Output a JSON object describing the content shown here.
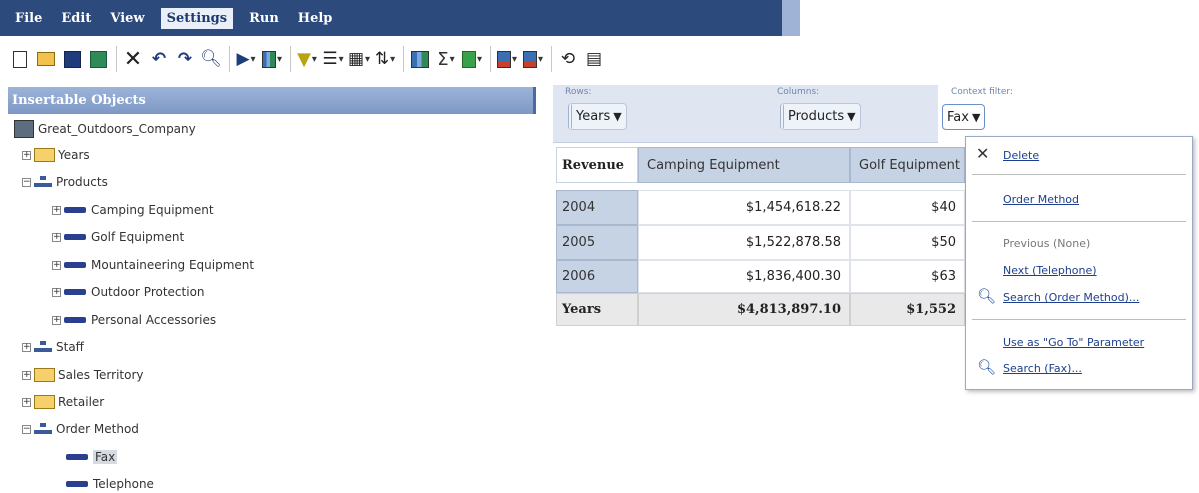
{
  "menu": [
    "File",
    "Edit",
    "View",
    "Settings",
    "Run",
    "Help"
  ],
  "menu_active": "Settings",
  "toolbar_icons": [
    "new-document-icon",
    "open-folder-icon",
    "save-icon",
    "save-as-icon",
    "delete-icon",
    "undo-icon",
    "redo-icon",
    "find-icon",
    "run-icon",
    "chart-type-icon",
    "filter-icon",
    "sort-icon",
    "summarize-icon",
    "explore-icon",
    "calculate-icon",
    "sum-icon",
    "insert-chart-icon",
    "chart-icon",
    "chart-config-icon",
    "refresh-icon",
    "properties-icon"
  ],
  "left_panel": {
    "title": "Insertable Objects",
    "package": "Great_Outdoors_Company",
    "items": {
      "years": "Years",
      "products": "Products",
      "camping": "Camping Equipment",
      "golf": "Golf Equipment",
      "mountaineering": "Mountaineering Equipment",
      "outdoor": "Outdoor Protection",
      "personal": "Personal Accessories",
      "staff": "Staff",
      "sales_territory": "Sales Territory",
      "retailer": "Retailer",
      "order_method": "Order Method",
      "fax": "Fax",
      "telephone": "Telephone"
    }
  },
  "zones": {
    "rows_label": "Rows:",
    "rows_value": "Years",
    "columns_label": "Columns:",
    "columns_value": "Products",
    "context_label": "Context filter:",
    "context_value": "Fax"
  },
  "crosstab": {
    "corner": "Revenue",
    "columns": [
      "Camping Equipment",
      "Golf Equipment"
    ],
    "rows": [
      {
        "label": "2004",
        "values": [
          "$1,454,618.22",
          "$40"
        ]
      },
      {
        "label": "2005",
        "values": [
          "$1,522,878.58",
          "$50"
        ]
      },
      {
        "label": "2006",
        "values": [
          "$1,836,400.30",
          "$63"
        ]
      }
    ],
    "total": {
      "label": "Years",
      "values": [
        "$4,813,897.10",
        "$1,552"
      ]
    }
  },
  "context_menu": {
    "delete": "Delete",
    "order_method": "Order Method",
    "previous": "Previous (None)",
    "next": "Next (Telephone)",
    "search_order": "Search (Order Method)...",
    "use_go_to": "Use as \"Go To\" Parameter",
    "search_fax": "Search (Fax)..."
  }
}
